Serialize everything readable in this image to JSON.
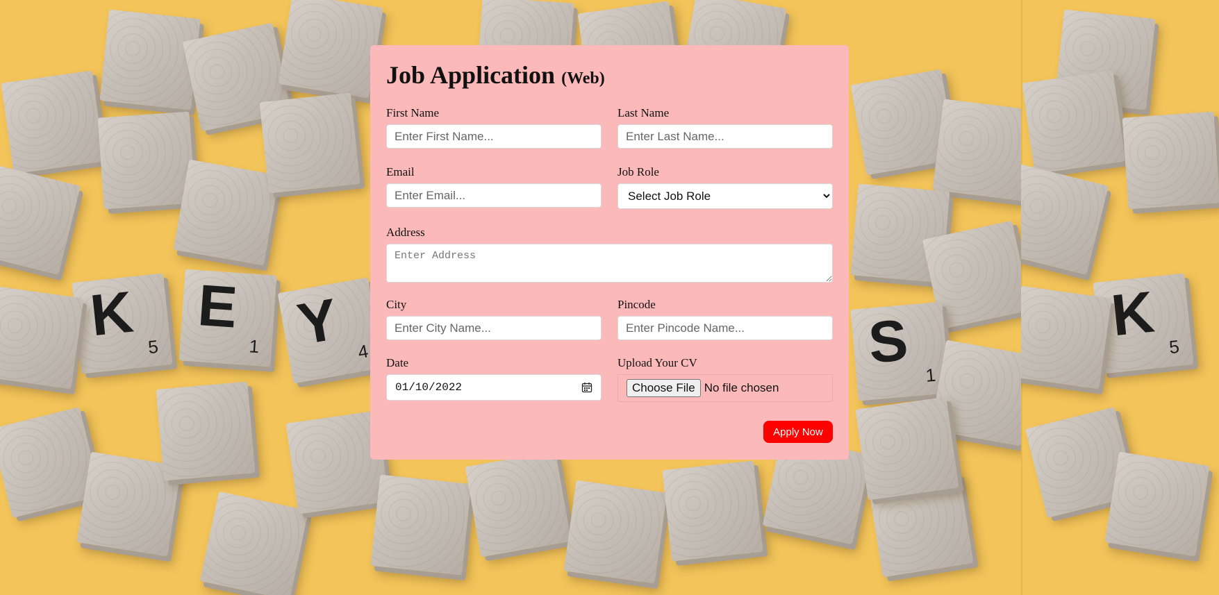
{
  "form": {
    "title": "Job Application",
    "title_suffix": "(Web)",
    "first_name": {
      "label": "First Name",
      "placeholder": "Enter First Name..."
    },
    "last_name": {
      "label": "Last Name",
      "placeholder": "Enter Last Name..."
    },
    "email": {
      "label": "Email",
      "placeholder": "Enter Email..."
    },
    "job_role": {
      "label": "Job Role",
      "selected": "Select Job Role"
    },
    "address": {
      "label": "Address",
      "placeholder": "Enter Address"
    },
    "city": {
      "label": "City",
      "placeholder": "Enter City Name..."
    },
    "pincode": {
      "label": "Pincode",
      "placeholder": "Enter Pincode Name..."
    },
    "date": {
      "label": "Date",
      "value": "01/10/2022"
    },
    "cv": {
      "label": "Upload Your CV",
      "button": "Choose File",
      "status": "No file chosen"
    },
    "submit_label": "Apply Now"
  },
  "background": {
    "tiles": [
      {
        "letter": "K",
        "score": "5"
      },
      {
        "letter": "E",
        "score": "1"
      },
      {
        "letter": "Y",
        "score": "4"
      },
      {
        "letter": "S",
        "score": "1"
      },
      {
        "letter": "K",
        "score": "5"
      }
    ]
  },
  "colors": {
    "page_background": "#f2c45a",
    "card_background": "#fbb9b9",
    "submit_button": "#ff0000"
  }
}
